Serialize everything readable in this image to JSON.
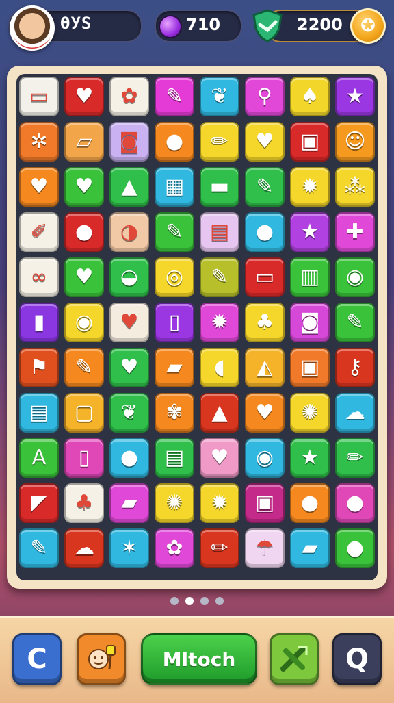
{
  "header": {
    "player_name": "ƟУS",
    "gems": "710",
    "coins": "2200",
    "star_icon": "star-icon"
  },
  "board": {
    "rows": [
      [
        {
          "icon": "picture-card",
          "c": "#f3f1ea",
          "g": "▭"
        },
        {
          "icon": "heart",
          "c": "#d92a2a",
          "g": "♥"
        },
        {
          "icon": "flower",
          "c": "#f5f1e6",
          "g": "✿"
        },
        {
          "icon": "paintbrush",
          "c": "#e53bd6",
          "g": "✎"
        },
        {
          "icon": "leaf",
          "c": "#31b8e0",
          "g": "❦"
        },
        {
          "icon": "magnifier",
          "c": "#e148d8",
          "g": "⚲"
        },
        {
          "icon": "mushroom",
          "c": "#f2d62a",
          "g": "♠"
        },
        {
          "icon": "star",
          "c": "#9a37e2",
          "g": "★"
        }
      ],
      [
        {
          "icon": "plant",
          "c": "#f07a2a",
          "g": "✲"
        },
        {
          "icon": "tablet",
          "c": "#f3a54a",
          "g": "▱"
        },
        {
          "icon": "camera",
          "c": "#cab2f2",
          "g": "◙"
        },
        {
          "icon": "balloon",
          "c": "#f5891f",
          "g": "●"
        },
        {
          "icon": "pencil",
          "c": "#f5d62a",
          "g": "✏"
        },
        {
          "icon": "heart",
          "c": "#f5d62a",
          "g": "♥"
        },
        {
          "icon": "picture-frame",
          "c": "#d92a2a",
          "g": "▣"
        },
        {
          "icon": "face",
          "c": "#f59a1f",
          "g": "☺"
        }
      ],
      [
        {
          "icon": "heart",
          "c": "#f5891f",
          "g": "♥"
        },
        {
          "icon": "heart",
          "c": "#3ac23a",
          "g": "♥"
        },
        {
          "icon": "arrow",
          "c": "#2fbf4a",
          "g": "▲"
        },
        {
          "icon": "grid",
          "c": "#31b8e0",
          "g": "▦"
        },
        {
          "icon": "folder",
          "c": "#2fbf4a",
          "g": "▬"
        },
        {
          "icon": "paintbrush",
          "c": "#2fbf4a",
          "g": "✎"
        },
        {
          "icon": "splat",
          "c": "#f5d62a",
          "g": "✹"
        },
        {
          "icon": "cherries",
          "c": "#f5d62a",
          "g": "⁂"
        }
      ],
      [
        {
          "icon": "crayon",
          "c": "#f5f1e6",
          "g": "✐"
        },
        {
          "icon": "lollipop",
          "c": "#d92a2a",
          "g": "●"
        },
        {
          "icon": "bubble",
          "c": "#f2c9a6",
          "g": "◑"
        },
        {
          "icon": "brush",
          "c": "#3ac23a",
          "g": "✎"
        },
        {
          "icon": "notepad",
          "c": "#e6c6f0",
          "g": "▤"
        },
        {
          "icon": "lemons",
          "c": "#31b8e0",
          "g": "●"
        },
        {
          "icon": "star",
          "c": "#b141e0",
          "g": "★"
        },
        {
          "icon": "puzzle",
          "c": "#e048d8",
          "g": "✚"
        }
      ],
      [
        {
          "icon": "peanuts",
          "c": "#f5f1e6",
          "g": "∞"
        },
        {
          "icon": "heart",
          "c": "#3ac23a",
          "g": "♥"
        },
        {
          "icon": "kettle",
          "c": "#2fbf4a",
          "g": "◒"
        },
        {
          "icon": "ring",
          "c": "#f5d62a",
          "g": "◎"
        },
        {
          "icon": "marker",
          "c": "#b7c02a",
          "g": "✎"
        },
        {
          "icon": "laptop",
          "c": "#d92a2a",
          "g": "▭"
        },
        {
          "icon": "bar-chart",
          "c": "#3ac23a",
          "g": "▥"
        },
        {
          "icon": "shell",
          "c": "#3ac23a",
          "g": "◉"
        }
      ],
      [
        {
          "icon": "bottle",
          "c": "#8a37e2",
          "g": "▮"
        },
        {
          "icon": "target",
          "c": "#f5d62a",
          "g": "◉"
        },
        {
          "icon": "heart",
          "c": "#f5ece0",
          "g": "♥"
        },
        {
          "icon": "battery",
          "c": "#9a37e2",
          "g": "▯"
        },
        {
          "icon": "splat",
          "c": "#e048d8",
          "g": "✹"
        },
        {
          "icon": "tree",
          "c": "#f5d62a",
          "g": "♣"
        },
        {
          "icon": "camera",
          "c": "#d648d8",
          "g": "◙"
        },
        {
          "icon": "brush",
          "c": "#3ac23a",
          "g": "✎"
        }
      ],
      [
        {
          "icon": "flag",
          "c": "#e0501f",
          "g": "⚑"
        },
        {
          "icon": "lipstick",
          "c": "#f5891f",
          "g": "✎"
        },
        {
          "icon": "heart",
          "c": "#2fbf4a",
          "g": "♥"
        },
        {
          "icon": "eraser",
          "c": "#f5891f",
          "g": "▰"
        },
        {
          "icon": "speech-bubble",
          "c": "#f5d62a",
          "g": "◖"
        },
        {
          "icon": "ruler",
          "c": "#f5b32a",
          "g": "◭"
        },
        {
          "icon": "picture-frame",
          "c": "#f07a2a",
          "g": "▣"
        },
        {
          "icon": "key",
          "c": "#d9361f",
          "g": "⚷"
        }
      ],
      [
        {
          "icon": "document",
          "c": "#31b8e0",
          "g": "▤"
        },
        {
          "icon": "bag",
          "c": "#f5b32a",
          "g": "▢"
        },
        {
          "icon": "leaf",
          "c": "#2fbf4a",
          "g": "❦"
        },
        {
          "icon": "ribbon",
          "c": "#f5891f",
          "g": "✾"
        },
        {
          "icon": "arrow",
          "c": "#d9361f",
          "g": "▲"
        },
        {
          "icon": "heart",
          "c": "#f5891f",
          "g": "♥"
        },
        {
          "icon": "sun",
          "c": "#f5d62a",
          "g": "✺"
        },
        {
          "icon": "cloud",
          "c": "#31b8e0",
          "g": "☁"
        }
      ],
      [
        {
          "icon": "letter-a",
          "c": "#3ac23a",
          "g": "A"
        },
        {
          "icon": "phone",
          "c": "#e048b8",
          "g": "▯"
        },
        {
          "icon": "bomb",
          "c": "#31b8e0",
          "g": "●"
        },
        {
          "icon": "window",
          "c": "#2fbf4a",
          "g": "▤"
        },
        {
          "icon": "heart",
          "c": "#f09ac8",
          "g": "♥"
        },
        {
          "icon": "speech-bubble",
          "c": "#31b8e0",
          "g": "◉"
        },
        {
          "icon": "star",
          "c": "#2fbf4a",
          "g": "★"
        },
        {
          "icon": "pencil",
          "c": "#2fbf4a",
          "g": "✏"
        }
      ],
      [
        {
          "icon": "cheese",
          "c": "#d92a2a",
          "g": "◤"
        },
        {
          "icon": "bush",
          "c": "#f5f1e6",
          "g": "♣"
        },
        {
          "icon": "folder",
          "c": "#e048d8",
          "g": "▰"
        },
        {
          "icon": "sun",
          "c": "#f5d62a",
          "g": "✺"
        },
        {
          "icon": "splat",
          "c": "#f5d62a",
          "g": "✹"
        },
        {
          "icon": "picture-frame",
          "c": "#c42a8a",
          "g": "▣"
        },
        {
          "icon": "tomato",
          "c": "#f5891f",
          "g": "●"
        },
        {
          "icon": "cherries",
          "c": "#e048b8",
          "g": "●"
        }
      ],
      [
        {
          "icon": "brush",
          "c": "#31b8e0",
          "g": "✎"
        },
        {
          "icon": "cloud",
          "c": "#d9361f",
          "g": "☁"
        },
        {
          "icon": "star",
          "c": "#31b8e0",
          "g": "✶"
        },
        {
          "icon": "gear",
          "c": "#e048d8",
          "g": "✿"
        },
        {
          "icon": "pencil",
          "c": "#d9361f",
          "g": "✏"
        },
        {
          "icon": "umbrella",
          "c": "#f0d6f0",
          "g": "☂"
        },
        {
          "icon": "eraser",
          "c": "#31b8e0",
          "g": "▰"
        },
        {
          "icon": "balloon",
          "c": "#3ac23a",
          "g": "●"
        }
      ]
    ]
  },
  "pager": {
    "pages": 4,
    "active": 1
  },
  "footer": {
    "undo_label": "C",
    "hint_icon": "hint-icon",
    "match_label": "Mltoch",
    "shuffle_icon": "shuffle-icon",
    "search_label": "Q"
  },
  "colors": {
    "board_frame": "#f4e3c4",
    "board_bg": "#2d3342",
    "accent_green": "#2fbf4a"
  }
}
